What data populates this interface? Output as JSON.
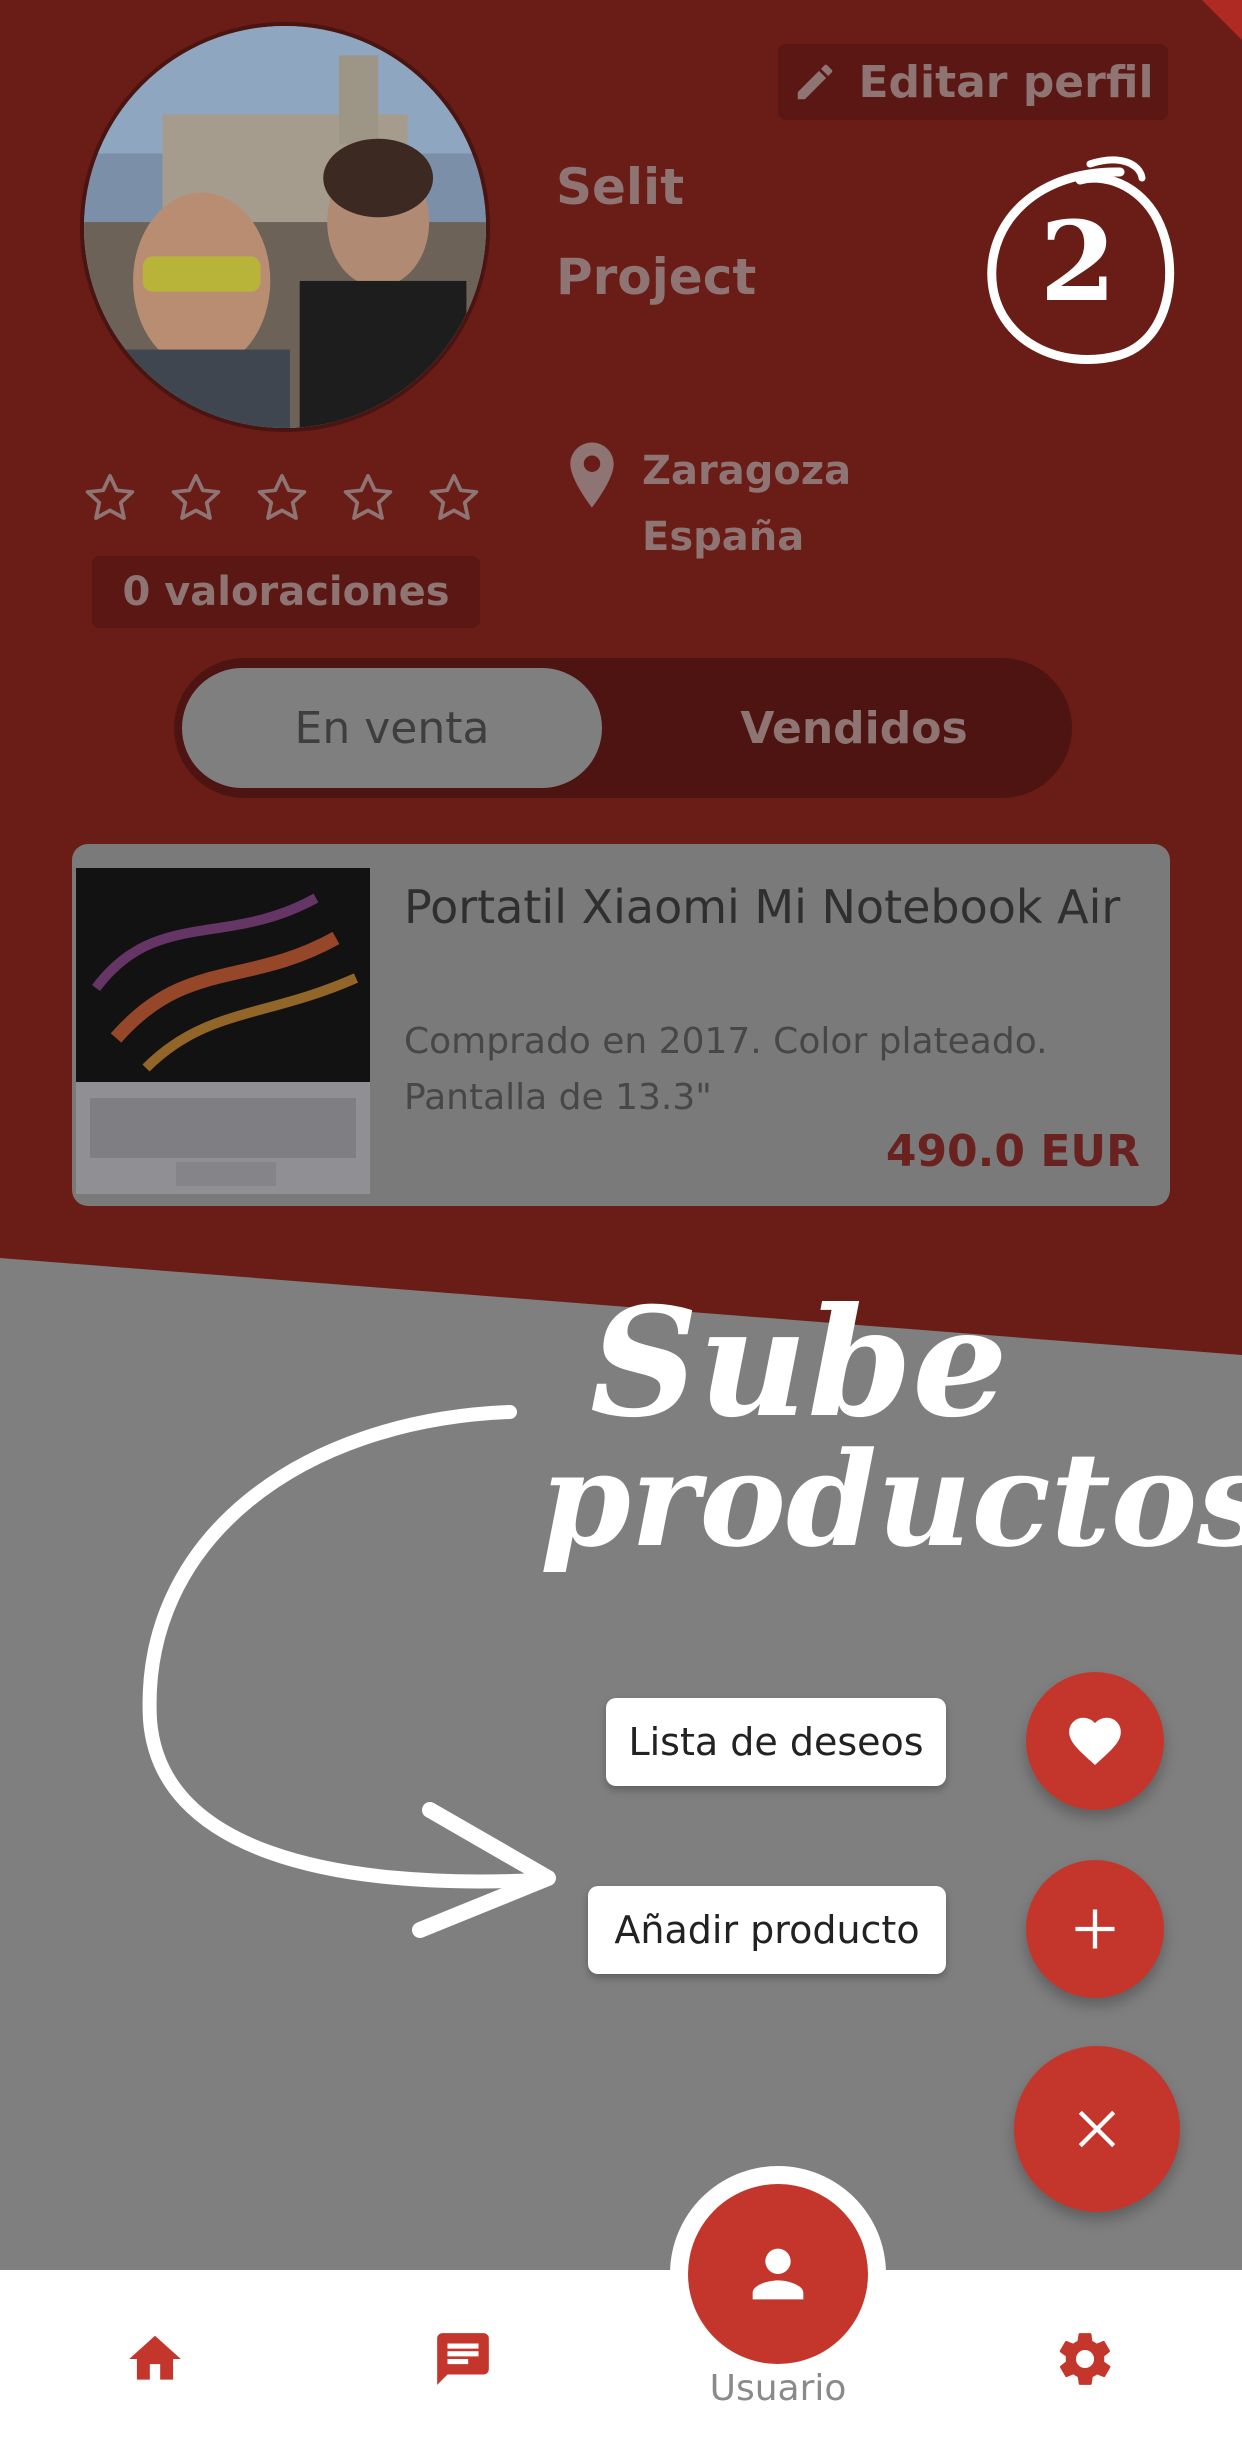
{
  "colors": {
    "brand_red": "#c4362c",
    "dimmed_red": "#6a1c17",
    "overlay_grey": "#7f7f7f",
    "white": "#ffffff"
  },
  "profile": {
    "edit_label": "Editar perfil",
    "name_line1": "Selit",
    "name_line2": "Project",
    "rating_stars": 0,
    "ratings_label": "0 valoraciones",
    "city": "Zaragoza",
    "country": "España"
  },
  "annotation": {
    "step_number": "2",
    "caption_line1": "Sube",
    "caption_line2": "productos"
  },
  "tabs": [
    {
      "label": "En venta",
      "active": true
    },
    {
      "label": "Vendidos",
      "active": false
    }
  ],
  "product": {
    "title": "Portatil Xiaomi Mi Notebook Air",
    "description": "Comprado en 2017. Color plateado. Pantalla de 13.3\"",
    "price": "490.0 EUR"
  },
  "fab_menu": {
    "wishlist_label": "Lista de deseos",
    "add_product_label": "Añadir producto"
  },
  "bottom_nav": {
    "user_label": "Usuario",
    "icons": [
      "home-icon",
      "chat-icon",
      "user-icon",
      "settings-icon"
    ]
  }
}
